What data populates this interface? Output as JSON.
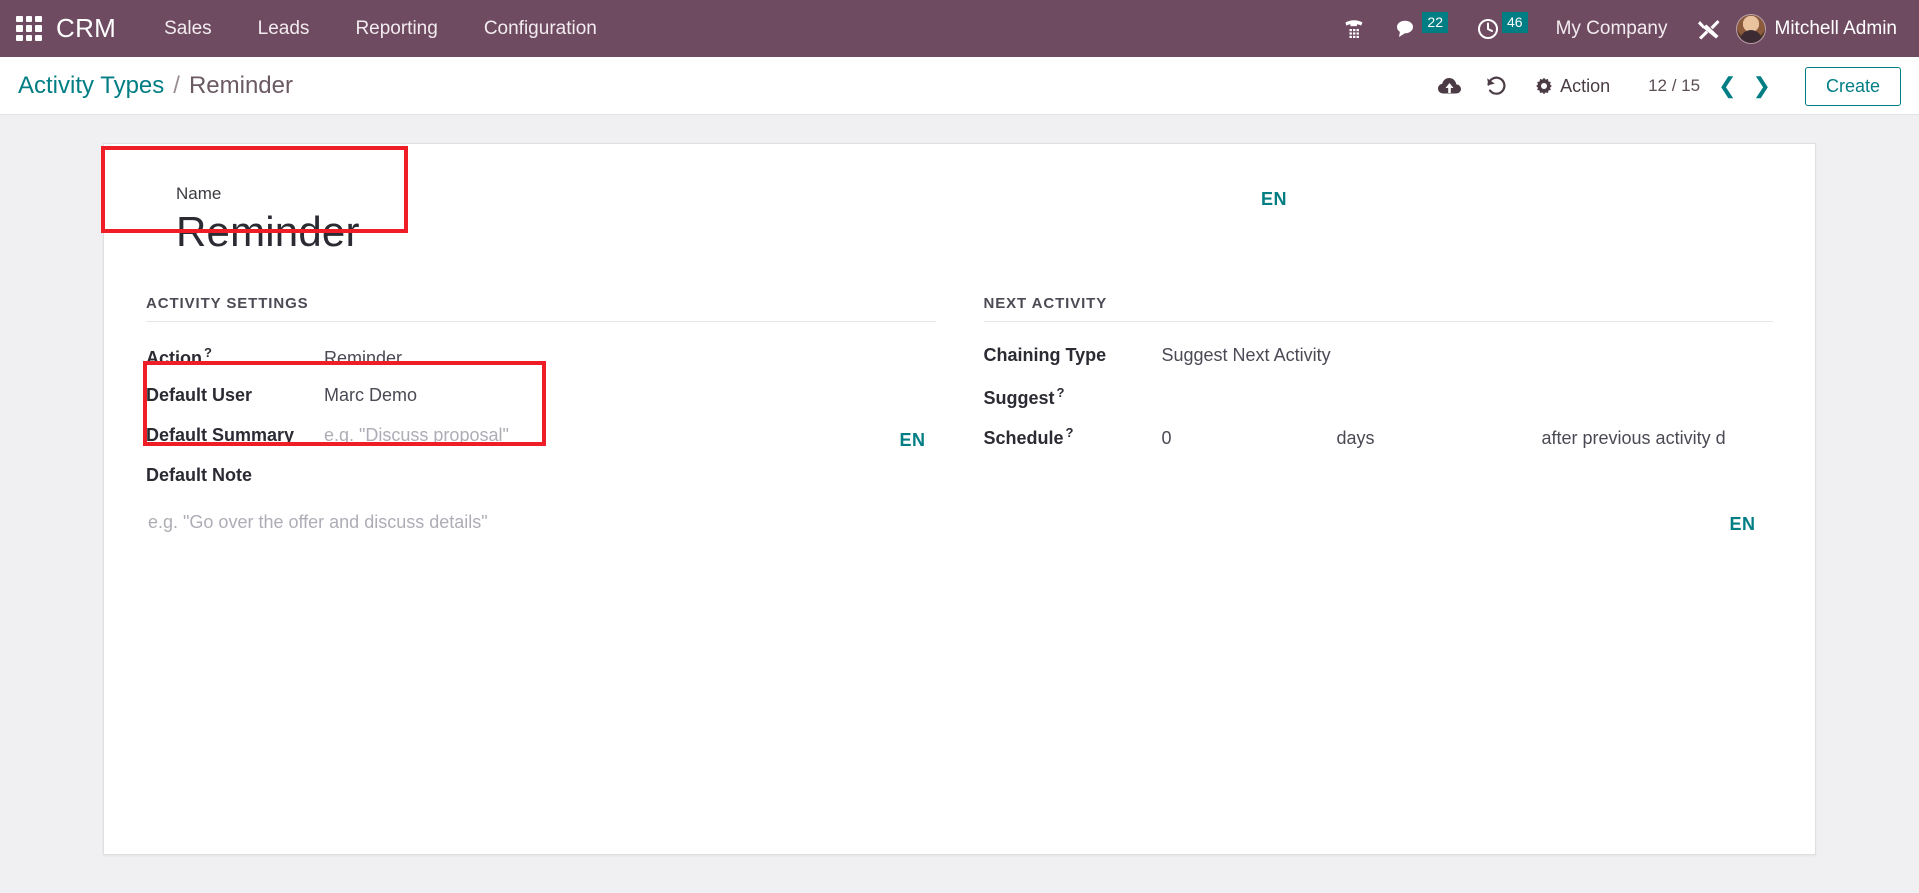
{
  "navbar": {
    "apps_icon": "apps-grid-icon",
    "brand": "CRM",
    "menu": [
      {
        "label": "Sales"
      },
      {
        "label": "Leads"
      },
      {
        "label": "Reporting"
      },
      {
        "label": "Configuration"
      }
    ],
    "systray": {
      "voip_icon": "phone-dialpad-icon",
      "messages_icon": "chat-bubble-icon",
      "messages_count": "22",
      "activities_icon": "clock-icon",
      "activities_count": "46",
      "company": "My Company",
      "tools_icon": "wrench-screwdriver-icon",
      "avatar_icon": "user-avatar",
      "user": "Mitchell Admin"
    },
    "colors": {
      "background": "#6f4b62",
      "badge": "#017e84",
      "text": "#ffffff"
    }
  },
  "control_panel": {
    "breadcrumb": {
      "parent": "Activity Types",
      "separator": "/",
      "current": "Reminder"
    },
    "save_icon": "cloud-upload-icon",
    "discard_icon": "undo-icon",
    "action_gear_icon": "gear-icon",
    "action_label": "Action",
    "pager": {
      "value": "12 / 15",
      "previous_icon": "chevron-left-icon",
      "next_icon": "chevron-right-icon"
    },
    "create_label": "Create",
    "colors": {
      "accent": "#017e84",
      "link": "#017e84"
    }
  },
  "form": {
    "name": {
      "label": "Name",
      "value": "Reminder",
      "translate_badge": "EN"
    },
    "activity_settings": {
      "title": "ACTIVITY SETTINGS",
      "action": {
        "label": "Action",
        "help": "?",
        "value": "Reminder"
      },
      "default_user": {
        "label": "Default User",
        "value": "Marc Demo"
      },
      "default_summary": {
        "label": "Default Summary",
        "placeholder": "e.g. \"Discuss proposal\"",
        "translate_badge": "EN"
      },
      "default_note": {
        "label": "Default Note",
        "placeholder": "e.g. \"Go over the offer and discuss details\"",
        "translate_badge": "EN"
      }
    },
    "next_activity": {
      "title": "NEXT ACTIVITY",
      "chaining_type": {
        "label": "Chaining Type",
        "value": "Suggest Next Activity"
      },
      "suggest": {
        "label": "Suggest",
        "help": "?",
        "value": ""
      },
      "schedule": {
        "label": "Schedule",
        "help": "?",
        "delay_count": "0",
        "delay_unit": "days",
        "delay_from": "after previous activity d"
      }
    }
  },
  "annotations": {
    "highlight_color": "#ef1d26",
    "boxes": [
      {
        "name": "name-field-highlight"
      },
      {
        "name": "activity-settings-highlight"
      }
    ]
  }
}
